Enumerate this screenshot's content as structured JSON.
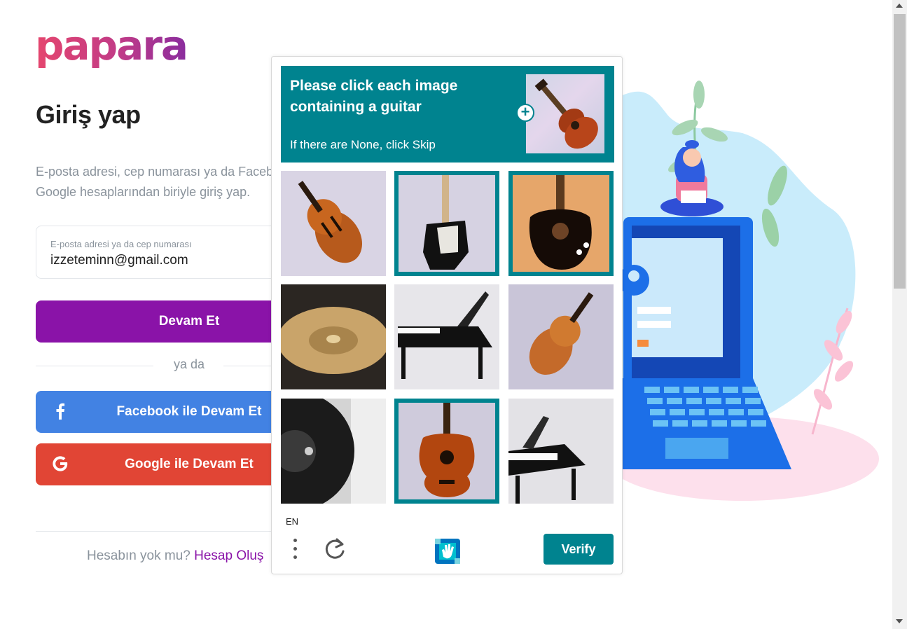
{
  "brand": {
    "logo_text": "papara"
  },
  "login": {
    "title": "Giriş yap",
    "description_line1": "E-posta adresi, cep numarası ya da Facebook,",
    "description_line2": "Google hesaplarından biriyle giriş yap.",
    "email_label": "E-posta adresi ya da cep numarası",
    "email_value": "izzeteminn@gmail.com",
    "continue_button": "Devam Et",
    "divider_text": "ya da",
    "facebook_button": "Facebook ile Devam Et",
    "google_button": "Google ile Devam Et",
    "signup_prompt": "Hesabın yok mu?",
    "signup_link": "Hesap Oluş"
  },
  "captcha": {
    "prompt": "Please click each image containing a guitar",
    "sub_prompt": "If there are None, click Skip",
    "language": "EN",
    "verify_button": "Verify",
    "tiles": [
      {
        "content": "violin",
        "selected": false
      },
      {
        "content": "electric guitar",
        "selected": true
      },
      {
        "content": "electric guitar",
        "selected": true
      },
      {
        "content": "cymbal",
        "selected": false
      },
      {
        "content": "grand piano",
        "selected": false
      },
      {
        "content": "violin",
        "selected": false
      },
      {
        "content": "vinyl record",
        "selected": false
      },
      {
        "content": "acoustic guitar",
        "selected": true
      },
      {
        "content": "grand piano",
        "selected": false
      }
    ],
    "icons": [
      "more-vertical-icon",
      "refresh-icon",
      "hcaptcha-logo-icon",
      "plus-icon"
    ]
  },
  "colors": {
    "brand_purple": "#8a13a8",
    "facebook_blue": "#4282e3",
    "google_red": "#e14535",
    "captcha_teal": "#00838f"
  }
}
